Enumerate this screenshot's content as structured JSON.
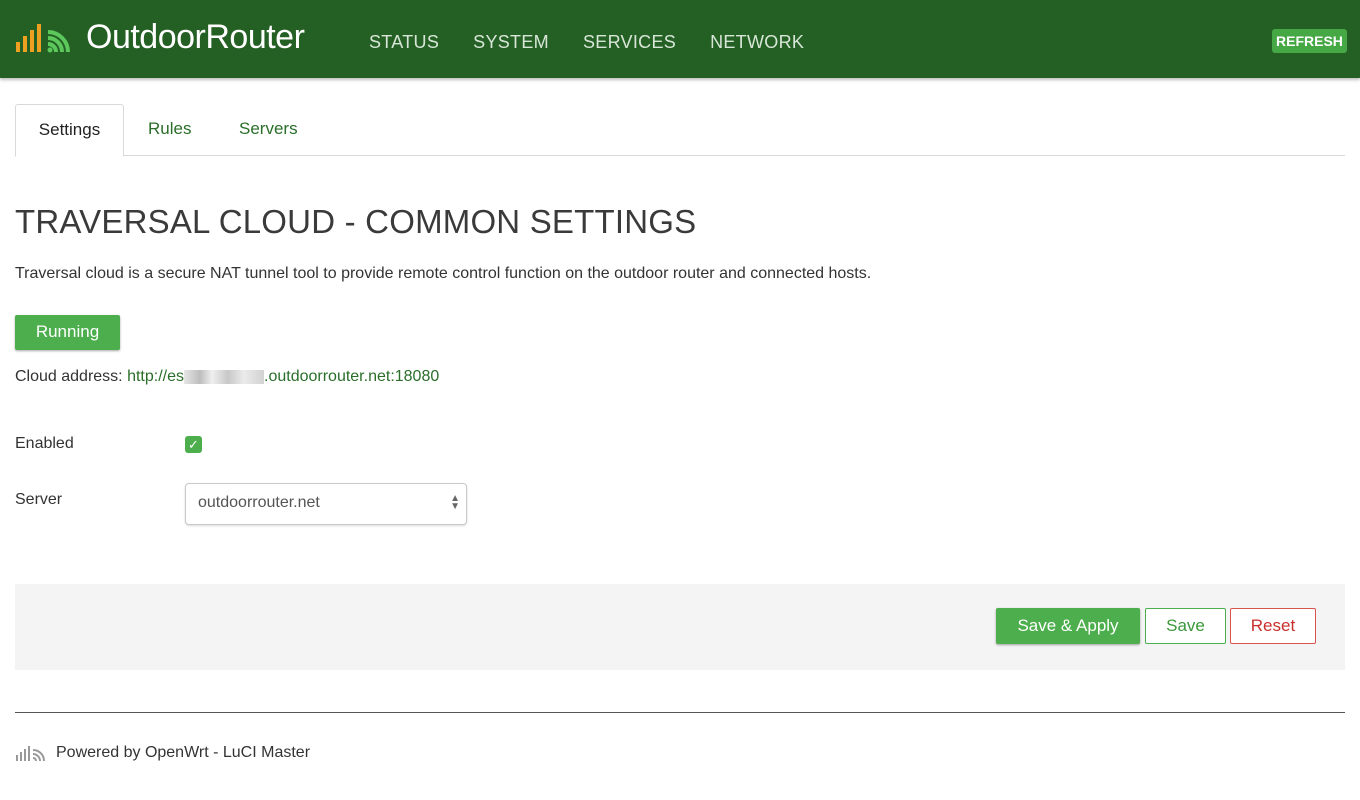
{
  "header": {
    "brand": "OutdoorRouter",
    "nav": [
      "STATUS",
      "SYSTEM",
      "SERVICES",
      "NETWORK"
    ],
    "refresh_label": "REFRESH",
    "logo_icon": "signal-bars-icon"
  },
  "tabs": [
    {
      "label": "Settings",
      "active": true
    },
    {
      "label": "Rules",
      "active": false
    },
    {
      "label": "Servers",
      "active": false
    }
  ],
  "page": {
    "title": "TRAVERSAL CLOUD - COMMON SETTINGS",
    "description": "Traversal cloud is a secure NAT tunnel tool to provide remote control function on the outdoor router and connected hosts.",
    "status_label": "Running",
    "cloud_address_label": "Cloud address:",
    "cloud_address_prefix": "http://es",
    "cloud_address_suffix": ".outdoorrouter.net:18080"
  },
  "form": {
    "enabled_label": "Enabled",
    "enabled_checked": true,
    "server_label": "Server",
    "server_value": "outdoorrouter.net"
  },
  "actions": {
    "save_apply": "Save & Apply",
    "save": "Save",
    "reset": "Reset"
  },
  "footer": {
    "text": "Powered by OpenWrt - LuCI Master"
  },
  "colors": {
    "header_bg": "#245f24",
    "accent_green": "#4cae4c",
    "reset_red": "#d9534f",
    "logo_orange": "#f0a020"
  }
}
